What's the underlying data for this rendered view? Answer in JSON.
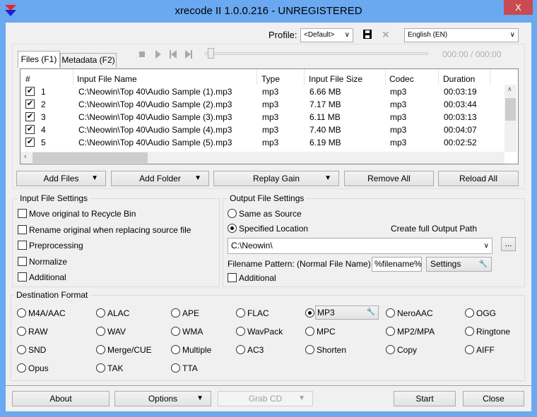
{
  "window": {
    "title": "xrecode II 1.0.0.216 - UNREGISTERED",
    "close": "X"
  },
  "toolbar": {
    "profile_label": "Profile:",
    "profile_value": "<Default>",
    "language_value": "English (EN)",
    "time": "000:00 / 000:00",
    "playback_progress": 0
  },
  "tabs": [
    {
      "label": "Files (F1)",
      "active": true
    },
    {
      "label": "Metadata (F2)",
      "active": false
    }
  ],
  "table": {
    "columns": [
      "#",
      "Input File Name",
      "Type",
      "Input File Size",
      "Codec",
      "Duration"
    ],
    "rows": [
      {
        "checked": true,
        "num": "1",
        "name": "C:\\Neowin\\Top 40\\Audio Sample (1).mp3",
        "type": "mp3",
        "size": "6.66 MB",
        "codec": "mp3",
        "duration": "00:03:19"
      },
      {
        "checked": true,
        "num": "2",
        "name": "C:\\Neowin\\Top 40\\Audio Sample (2).mp3",
        "type": "mp3",
        "size": "7.17 MB",
        "codec": "mp3",
        "duration": "00:03:44"
      },
      {
        "checked": true,
        "num": "3",
        "name": "C:\\Neowin\\Top 40\\Audio Sample (3).mp3",
        "type": "mp3",
        "size": "6.11 MB",
        "codec": "mp3",
        "duration": "00:03:13"
      },
      {
        "checked": true,
        "num": "4",
        "name": "C:\\Neowin\\Top 40\\Audio Sample (4).mp3",
        "type": "mp3",
        "size": "7.40 MB",
        "codec": "mp3",
        "duration": "00:04:07"
      },
      {
        "checked": true,
        "num": "5",
        "name": "C:\\Neowin\\Top 40\\Audio Sample (5).mp3",
        "type": "mp3",
        "size": "6.19 MB",
        "codec": "mp3",
        "duration": "00:02:52"
      }
    ]
  },
  "file_buttons": {
    "add_files": "Add Files",
    "add_folder": "Add Folder",
    "replay_gain": "Replay Gain",
    "remove_all": "Remove All",
    "reload_all": "Reload All"
  },
  "input_settings": {
    "title": "Input File Settings",
    "options": [
      {
        "label": "Move original to Recycle Bin",
        "checked": false
      },
      {
        "label": "Rename original when replacing source file",
        "checked": false
      },
      {
        "label": "Preprocessing",
        "checked": false
      },
      {
        "label": "Normalize",
        "checked": false
      },
      {
        "label": "Additional",
        "checked": false
      }
    ]
  },
  "output_settings": {
    "title": "Output File Settings",
    "same_as_source": "Same as Source",
    "specified_location": "Specified Location",
    "create_full_path": "Create full Output Path",
    "path": "C:\\Neowin\\",
    "browse": "...",
    "pattern_label": "Filename Pattern: (Normal File Name)",
    "pattern_value": "%filename%",
    "settings": "Settings",
    "additional": "Additional"
  },
  "destination": {
    "title": "Destination Format",
    "selected": "MP3",
    "formats": [
      [
        "M4A/AAC",
        "ALAC",
        "APE",
        "FLAC",
        "MP3",
        "NeroAAC",
        "OGG"
      ],
      [
        "RAW",
        "WAV",
        "WMA",
        "WavPack",
        "MPC",
        "MP2/MPA",
        "Ringtone"
      ],
      [
        "SND",
        "Merge/CUE",
        "Multiple",
        "AC3",
        "Shorten",
        "Copy",
        "AIFF"
      ],
      [
        "Opus",
        "TAK",
        "TTA"
      ]
    ]
  },
  "bottom": {
    "about": "About",
    "options": "Options",
    "grab_cd": "Grab CD",
    "start": "Start",
    "close": "Close"
  }
}
